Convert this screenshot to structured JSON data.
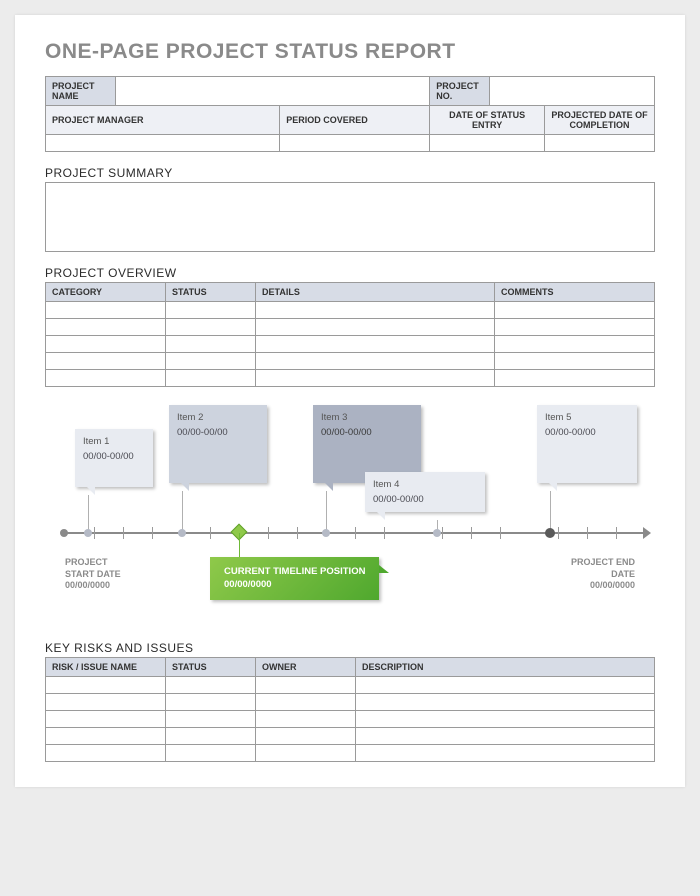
{
  "title": "ONE-PAGE PROJECT STATUS REPORT",
  "header": {
    "projectNameLabel": "PROJECT NAME",
    "projectNoLabel": "PROJECT NO.",
    "projectManagerLabel": "PROJECT MANAGER",
    "periodCoveredLabel": "PERIOD COVERED",
    "dateOfStatusEntryLabel": "DATE OF STATUS ENTRY",
    "projectedDateLabel": "PROJECTED DATE OF COMPLETION"
  },
  "sections": {
    "summary": "PROJECT SUMMARY",
    "overview": "PROJECT OVERVIEW",
    "risks": "KEY RISKS AND ISSUES"
  },
  "overview": {
    "cols": {
      "category": "CATEGORY",
      "status": "STATUS",
      "details": "DETAILS",
      "comments": "COMMENTS"
    }
  },
  "risks": {
    "cols": {
      "name": "RISK / ISSUE NAME",
      "status": "STATUS",
      "owner": "OWNER",
      "description": "DESCRIPTION"
    }
  },
  "timeline": {
    "startLabel": "PROJECT START DATE",
    "startDate": "00/00/0000",
    "endLabel": "PROJECT END DATE",
    "endDate": "00/00/0000",
    "currentLabel": "CURRENT TIMELINE POSITION",
    "currentDate": "00/00/0000",
    "items": [
      {
        "title": "Item 1",
        "date": "00/00-00/00"
      },
      {
        "title": "Item 2",
        "date": "00/00-00/00"
      },
      {
        "title": "Item 3",
        "date": "00/00-00/00"
      },
      {
        "title": "Item 4",
        "date": "00/00-00/00"
      },
      {
        "title": "Item 5",
        "date": "00/00-00/00"
      }
    ]
  },
  "chart_data": {
    "type": "table",
    "title": "Project Timeline",
    "items": [
      {
        "label": "Item 1",
        "range": "00/00-00/00"
      },
      {
        "label": "Item 2",
        "range": "00/00-00/00"
      },
      {
        "label": "Item 3",
        "range": "00/00-00/00"
      },
      {
        "label": "Item 4",
        "range": "00/00-00/00"
      },
      {
        "label": "Item 5",
        "range": "00/00-00/00"
      }
    ],
    "start": "00/00/0000",
    "end": "00/00/0000",
    "current": "00/00/0000"
  }
}
